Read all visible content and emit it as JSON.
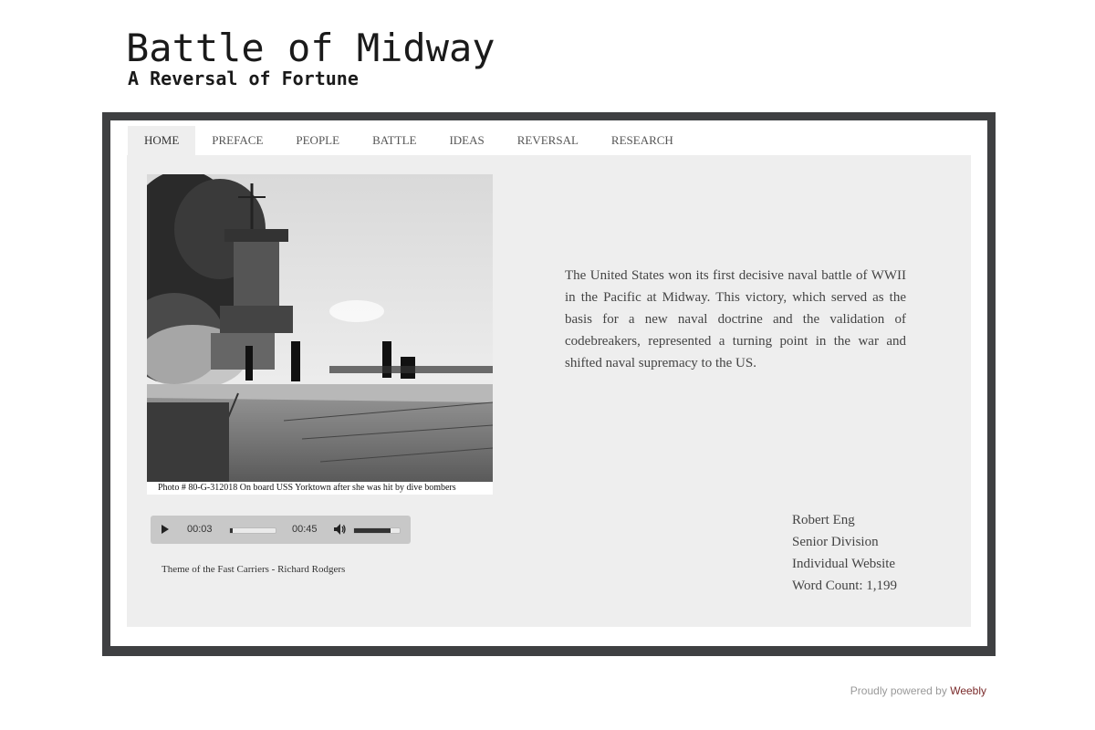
{
  "header": {
    "title": "Battle of Midway",
    "subtitle": "A Reversal of Fortune"
  },
  "nav": {
    "items": [
      {
        "label": "HOME",
        "active": true
      },
      {
        "label": "PREFACE"
      },
      {
        "label": "PEOPLE"
      },
      {
        "label": "BATTLE"
      },
      {
        "label": "IDEAS"
      },
      {
        "label": "REVERSAL"
      },
      {
        "label": "RESEARCH"
      }
    ]
  },
  "photo": {
    "caption": "Photo #  80-G-312018   On board USS Yorktown after she was hit by dive bombers"
  },
  "intro_text": "The United States won its first decisive naval battle of WWII in the Pacific at Midway. This victory, which served as the basis for a new naval doctrine and the validation of codebreakers, represented a turning point in the war and shifted naval supremacy to the US.",
  "audio": {
    "current_time": "00:03",
    "duration": "00:45",
    "progress": 0.067,
    "volume": 0.8,
    "play_icon": "play-icon",
    "volume_icon": "speaker-icon",
    "track_title": "Theme of the Fast Carriers - Richard Rodgers"
  },
  "credits": {
    "name": "Robert Eng",
    "division": "Senior Division",
    "category": "Individual Website",
    "word_count": "Word Count: 1,199"
  },
  "footer": {
    "prefix": "Proudly powered by",
    "link": "Weebly"
  },
  "colors": {
    "frame": "#3f4042",
    "content_bg": "#eeeeee",
    "footer_link": "#7a2a2a"
  }
}
